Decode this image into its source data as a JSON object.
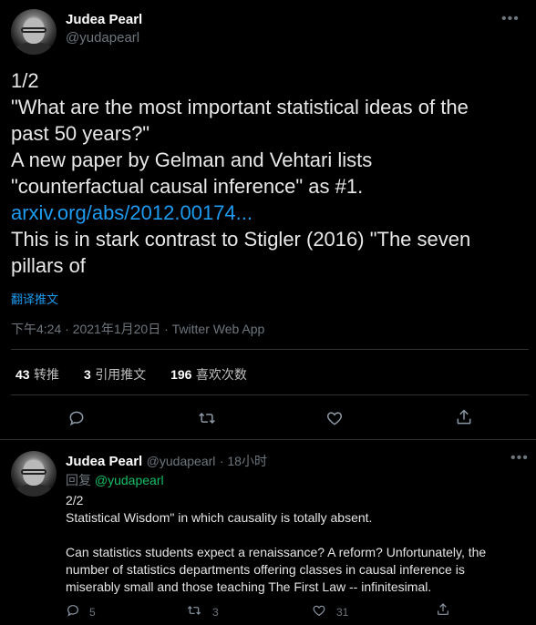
{
  "tweet": {
    "author_name": "Judea Pearl",
    "author_handle": "@yudapearl",
    "lines": [
      "1/2",
      "\"What are the most important statistical ideas of the",
      "past 50 years?\"",
      "A new paper by Gelman and Vehtari  lists",
      "\"counterfactual causal inference\" as #1."
    ],
    "link": "arxiv.org/abs/2012.00174...",
    "lines_after": [
      "This is in stark contrast to Stigler (2016) \"The seven",
      "pillars of"
    ],
    "translate": "翻译推文",
    "timestamp": "下午4:24 · 2021年1月20日 · Twitter Web App",
    "stats": {
      "retweets_num": "43",
      "retweets_label": "转推",
      "quotes_num": "3",
      "quotes_label": "引用推文",
      "likes_num": "196",
      "likes_label": "喜欢次数"
    }
  },
  "reply": {
    "author_name": "Judea Pearl",
    "author_handle": "@yudapearl",
    "time": "· 18小时",
    "replying_label": "回复",
    "replying_handle": "@yudapearl",
    "lines": [
      "2/2",
      "Statistical Wisdom\" in which causality is totally absent.",
      "",
      "Can statistics students expect a renaissance? A reform? Unfortunately, the",
      "number of statistics departments offering classes in causal inference is",
      "miserably small and those teaching The First Law -- infinitesimal."
    ],
    "counts": {
      "replies": "5",
      "retweets": "3",
      "likes": "31"
    }
  },
  "colors": {
    "accent": "#1d9bf0",
    "background": "#000000",
    "muted": "#6e767d"
  },
  "icons": [
    "more-icon",
    "reply-icon",
    "retweet-icon",
    "like-icon",
    "share-icon"
  ]
}
